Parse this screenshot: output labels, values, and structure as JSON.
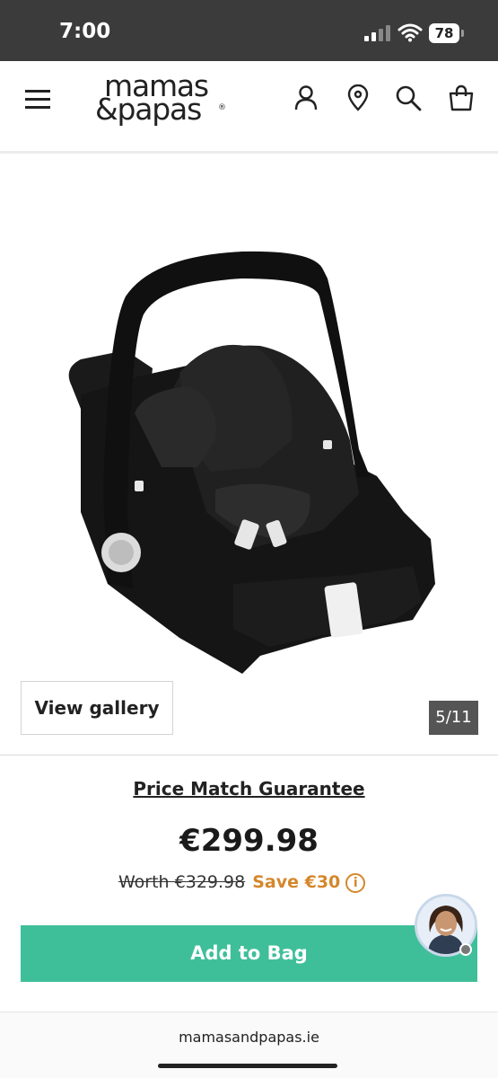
{
  "status_bar": {
    "time": "7:00",
    "battery": "78"
  },
  "header": {
    "logo_line1": "mamas",
    "logo_line2": "&papas",
    "logo_reg": "®"
  },
  "gallery": {
    "button_label": "View gallery",
    "counter": "5/11"
  },
  "pricing": {
    "price_match_label": "Price Match Guarantee",
    "price": "€299.98",
    "worth": "Worth €329.98",
    "save": "Save €30",
    "info_glyph": "i"
  },
  "cta": {
    "add_to_bag": "Add to Bag"
  },
  "browser": {
    "url": "mamasandpapas.ie"
  },
  "colors": {
    "accent_green": "#3fbf99",
    "save_orange": "#d4872b",
    "status_bar_bg": "#3b3b3b"
  },
  "icons": [
    "hamburger-menu-icon",
    "account-icon",
    "store-locator-icon",
    "search-icon",
    "bag-icon",
    "info-icon"
  ]
}
